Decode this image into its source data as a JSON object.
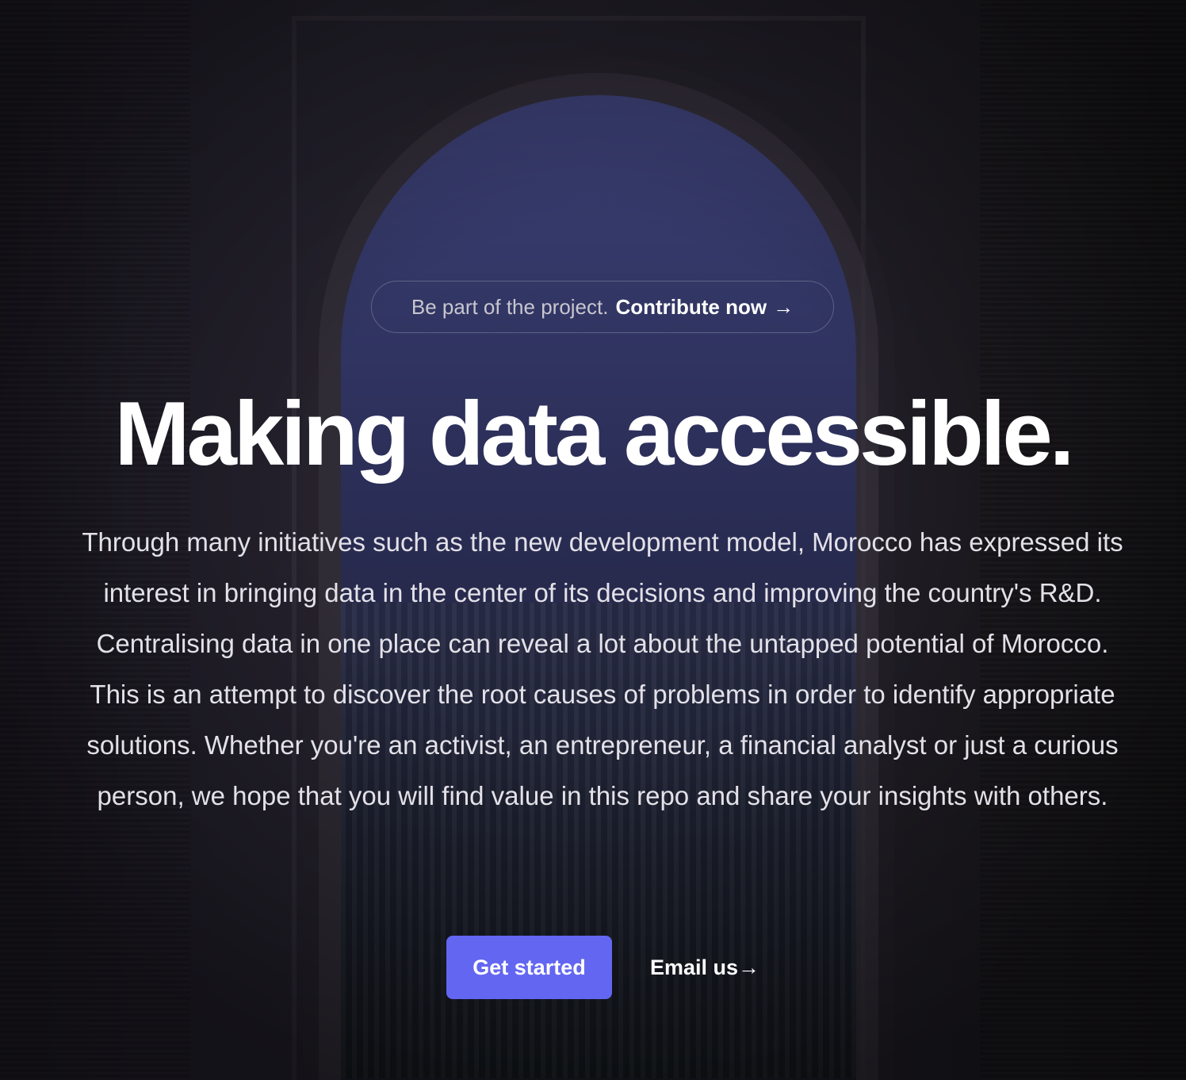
{
  "announcement": {
    "lead_text": "Be part of the project.",
    "link_label": "Contribute now",
    "link_arrow": "→"
  },
  "hero": {
    "title": "Making data accessible.",
    "description": "Through many initiatives such as the new development model, Morocco has expressed its interest in bringing data in the center of its decisions and improving the country's R&D. Centralising data in one place can reveal a lot about the untapped potential of Morocco. This is an attempt to discover the root causes of problems in order to identify appropriate solutions. Whether you're an activist, an entrepreneur, a financial analyst or just a curious person, we hope that you will find value in this repo and share your insights with others."
  },
  "actions": {
    "primary_label": "Get started",
    "secondary_label": "Email us",
    "secondary_arrow": "→"
  },
  "colors": {
    "accent": "#6366f1",
    "text": "#ffffff",
    "muted_text": "#c8c6cf",
    "background": "#1e1b24"
  }
}
